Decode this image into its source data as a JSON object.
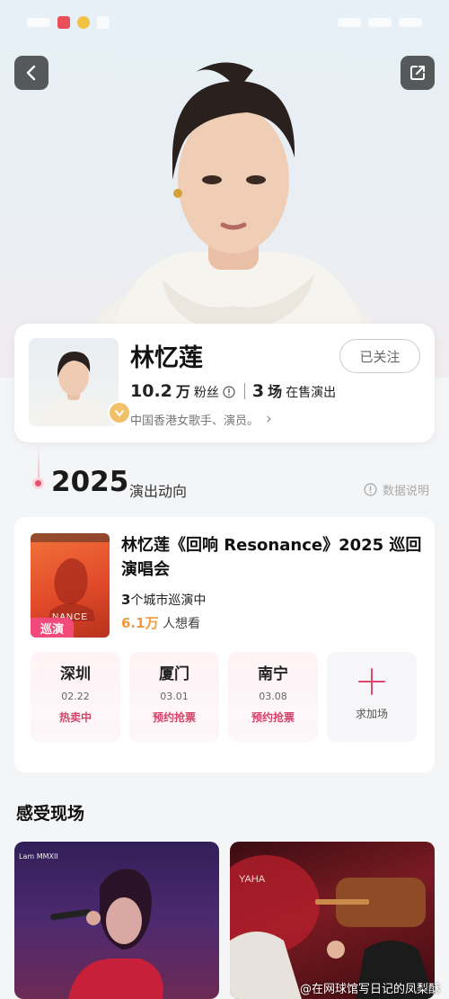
{
  "header": {
    "back_icon": "chevron-left-icon",
    "share_icon": "share-icon"
  },
  "artist": {
    "name": "林忆莲",
    "follow_label": "已关注",
    "followers_value": "10.2",
    "followers_unit": "万",
    "followers_label": "粉丝",
    "shows_value": "3",
    "shows_unit": "场",
    "shows_label": "在售演出",
    "description": "中国香港女歌手、演员。",
    "desc_arrow": "›"
  },
  "timeline": {
    "year": "2025",
    "subtitle": "演出动向",
    "data_note": "数据说明"
  },
  "tour": {
    "title": "林忆莲《回响 Resonance》2025 巡回演唱会",
    "poster_tag": "巡演",
    "cities_count": "3",
    "cities_text": "个城市巡演中",
    "want_count": "6.1万",
    "want_text": " 人想看",
    "cities": [
      {
        "name": "深圳",
        "date": "02.22",
        "status": "热卖中"
      },
      {
        "name": "厦门",
        "date": "03.01",
        "status": "预约抢票"
      },
      {
        "name": "南宁",
        "date": "03.08",
        "status": "预约抢票"
      }
    ],
    "add_label": "求加场"
  },
  "live": {
    "title": "感受现场",
    "stamp_left": "Lam MMXII"
  },
  "watermark": "@在网球馆写日记的凤梨酥",
  "colors": {
    "accent_pink": "#e0486e",
    "status_pink": "#d3446a",
    "want_orange": "#f2993a",
    "tag_pink": "#f24a7a"
  }
}
